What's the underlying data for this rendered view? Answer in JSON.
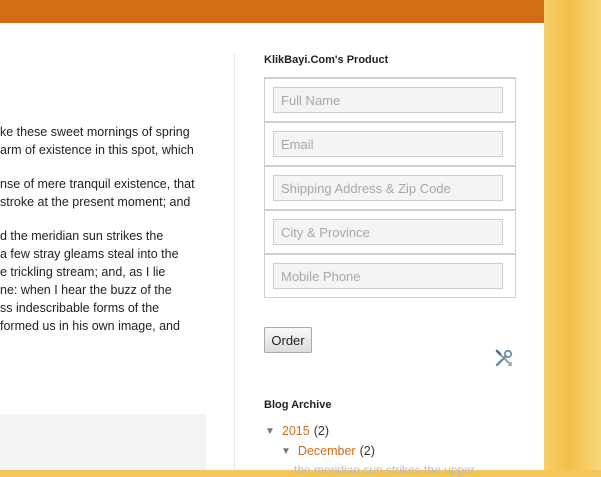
{
  "header": {
    "bar_color": "#d26d16"
  },
  "post": {
    "paragraphs": [
      [
        "ke these sweet mornings of spring",
        "arm of existence in this spot, which"
      ],
      [
        "nse of mere tranquil existence, that",
        "stroke at the present moment; and"
      ],
      [
        "d the meridian sun strikes the",
        "a few stray gleams steal into the",
        "e trickling stream; and, as I lie",
        "ne: when I hear the buzz of the",
        "ss indescribable forms of the",
        "formed us in his own image, and"
      ]
    ]
  },
  "sidebar": {
    "product_widget": {
      "title": "KlikBayi.Com's Product",
      "fields": [
        {
          "placeholder": "Full Name"
        },
        {
          "placeholder": "Email"
        },
        {
          "placeholder": "Shipping Address & Zip Code"
        },
        {
          "placeholder": "City & Province"
        },
        {
          "placeholder": "Mobile Phone"
        }
      ],
      "order_label": "Order",
      "edit_icon": "tools-icon"
    },
    "archive": {
      "title": "Blog Archive",
      "year": {
        "label": "2015",
        "count": "(2)"
      },
      "month": {
        "label": "December",
        "count": "(2)"
      },
      "post_snippet": "the meridian sun strikes the upper"
    }
  },
  "colors": {
    "accent": "#d26d16",
    "background_gold": "#f1bf48"
  }
}
